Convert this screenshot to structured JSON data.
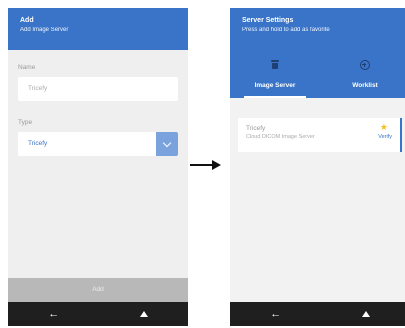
{
  "left_screen": {
    "title": "Add",
    "subtitle": "Add Image Server",
    "name_label": "Name",
    "name_value": "Tricefy",
    "type_label": "Type",
    "type_value": "Tricefy",
    "add_button": "Add",
    "nav": {
      "back_icon": "back-arrow-icon",
      "home_icon": "home-triangle-icon"
    }
  },
  "right_screen": {
    "title": "Server Settings",
    "subtitle": "Press and hold to add as favorite",
    "toolbar_icons": [
      "trash-icon",
      "add-circle-icon"
    ],
    "tabs": [
      {
        "label": "Image Server",
        "active": true
      },
      {
        "label": "Worklist",
        "active": false
      }
    ],
    "server": {
      "name": "Tricefy",
      "description": "Cloud DICOM Image Server",
      "action": "Verify",
      "favorite_icon": "star-icon"
    },
    "nav": {
      "back_icon": "back-arrow-icon",
      "home_icon": "home-triangle-icon"
    }
  },
  "colors": {
    "primary": "#3a74c8",
    "accent_star": "#f4c21b",
    "navbar": "#1f1f1f"
  }
}
